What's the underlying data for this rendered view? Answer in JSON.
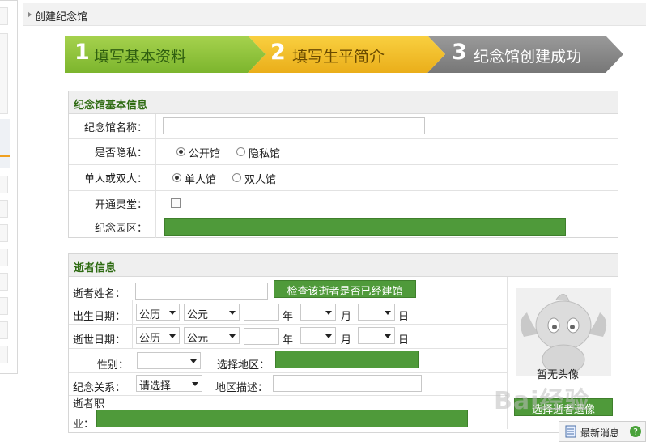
{
  "header": {
    "title": "创建纪念馆"
  },
  "steps": [
    {
      "num": "1",
      "label": "填写基本资料",
      "color": "#8fc43c"
    },
    {
      "num": "2",
      "label": "填写生平简介",
      "color": "#f3bf2c"
    },
    {
      "num": "3",
      "label": "纪念馆创建成功",
      "color": "#8a8a8a"
    }
  ],
  "basic": {
    "title": "纪念馆基本信息",
    "name_label": "纪念馆名称：",
    "name_value": "",
    "privacy_label": "是否隐私：",
    "privacy_options": [
      "公开馆",
      "隐私馆"
    ],
    "privacy_selected": "公开馆",
    "type_label": "单人或双人：",
    "type_options": [
      "单人馆",
      "双人馆"
    ],
    "type_selected": "单人馆",
    "hall_label": "开通灵堂：",
    "hall_checked": false,
    "park_label": "纪念园区："
  },
  "deceased": {
    "title": "逝者信息",
    "name_label": "逝者姓名：",
    "check_button": "检查该逝者是否已经建馆",
    "birth_label": "出生日期：",
    "death_label": "逝世日期：",
    "calendar": "公历",
    "era": "公元",
    "year_unit": "年",
    "month_unit": "月",
    "day_unit": "日",
    "gender_label": "性别：",
    "region_label": "选择地区：",
    "relation_label": "纪念关系：",
    "relation_value": "请选择",
    "region_desc_label": "地区描述：",
    "job_label_1": "逝者职",
    "job_label_2": "业：",
    "avatar_caption": "暂无头像",
    "choose_avatar_button": "选择逝者遗像"
  },
  "watermark": "Bai经验",
  "news_label": "最新消息"
}
